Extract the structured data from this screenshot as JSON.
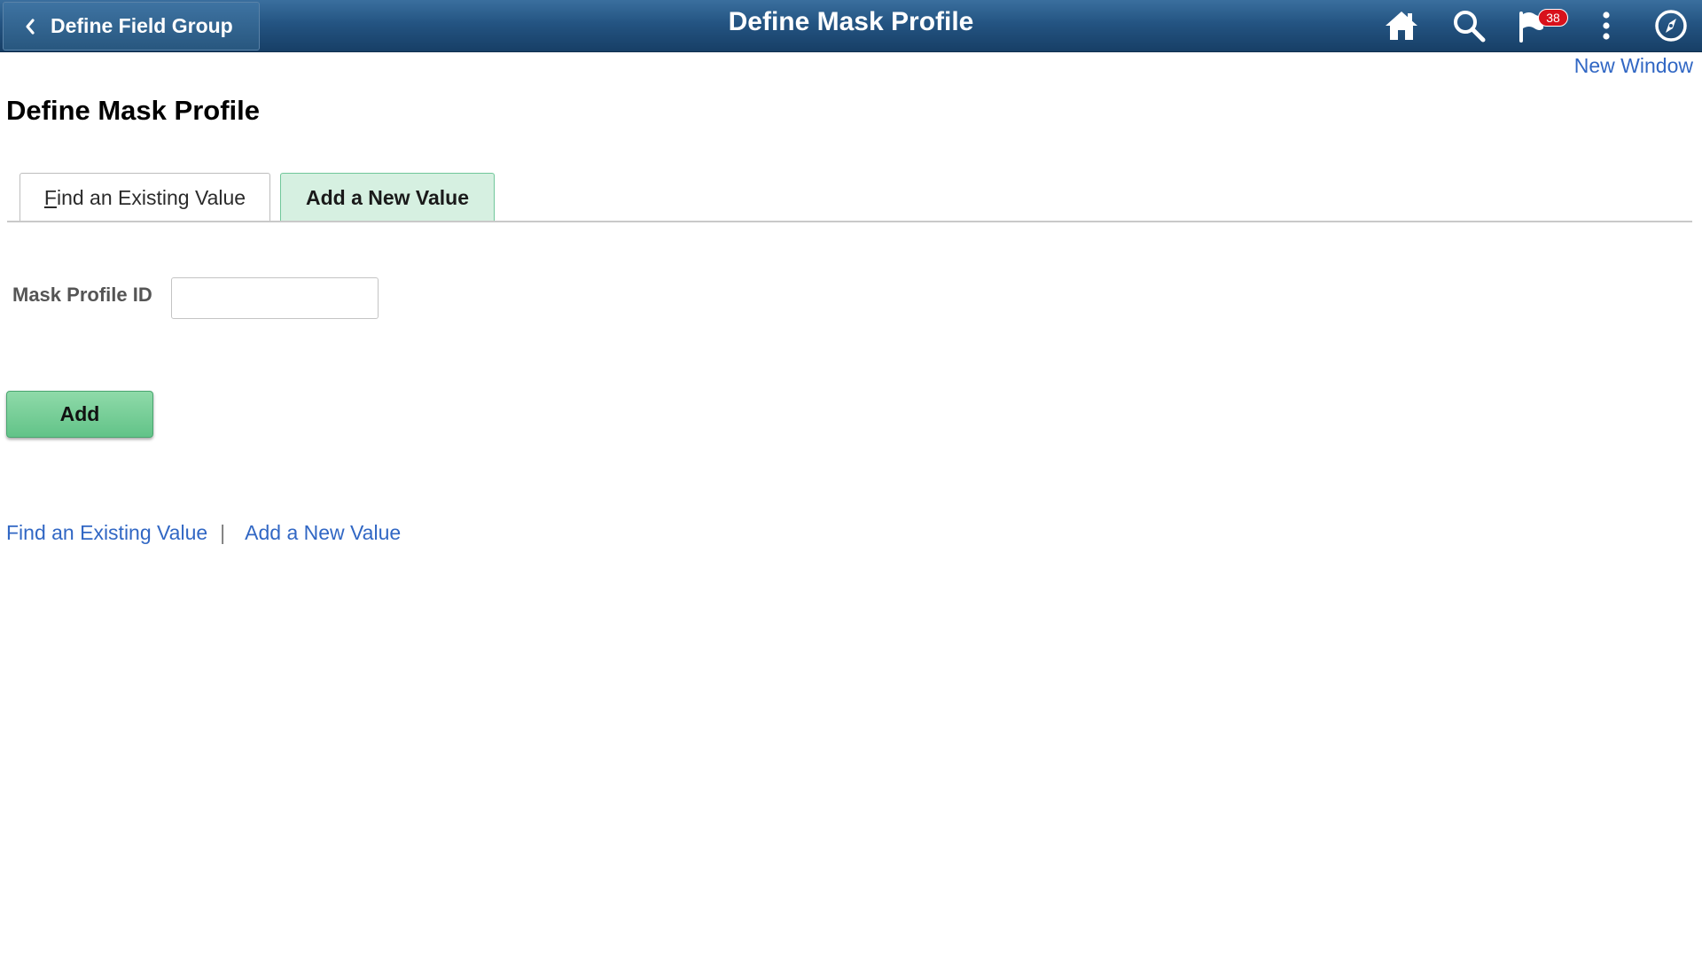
{
  "header": {
    "back_label": "Define Field Group",
    "title": "Define Mask Profile",
    "notification_count": "38",
    "bar_color": "#245482",
    "icons": [
      "chevron-left-icon",
      "home-icon",
      "search-icon",
      "flag-icon",
      "more-vertical-icon",
      "compass-icon"
    ]
  },
  "new_window_label": "New Window",
  "page_title": "Define Mask Profile",
  "tabs": [
    {
      "label_first": "F",
      "label_rest": "ind an Existing Value",
      "selected": false
    },
    {
      "label": "Add a New Value",
      "selected": true
    }
  ],
  "form": {
    "mask_profile_id_label": "Mask Profile ID",
    "mask_profile_id_value": ""
  },
  "add_button_label": "Add",
  "footer_links": {
    "find_label": "Find an Existing Value",
    "separator": "|",
    "add_label": "Add a New Value"
  },
  "colors": {
    "link": "#3167c4",
    "selected_tab": "#d6f0e1",
    "primary_button": "#6fc892",
    "badge": "#d8111b"
  }
}
